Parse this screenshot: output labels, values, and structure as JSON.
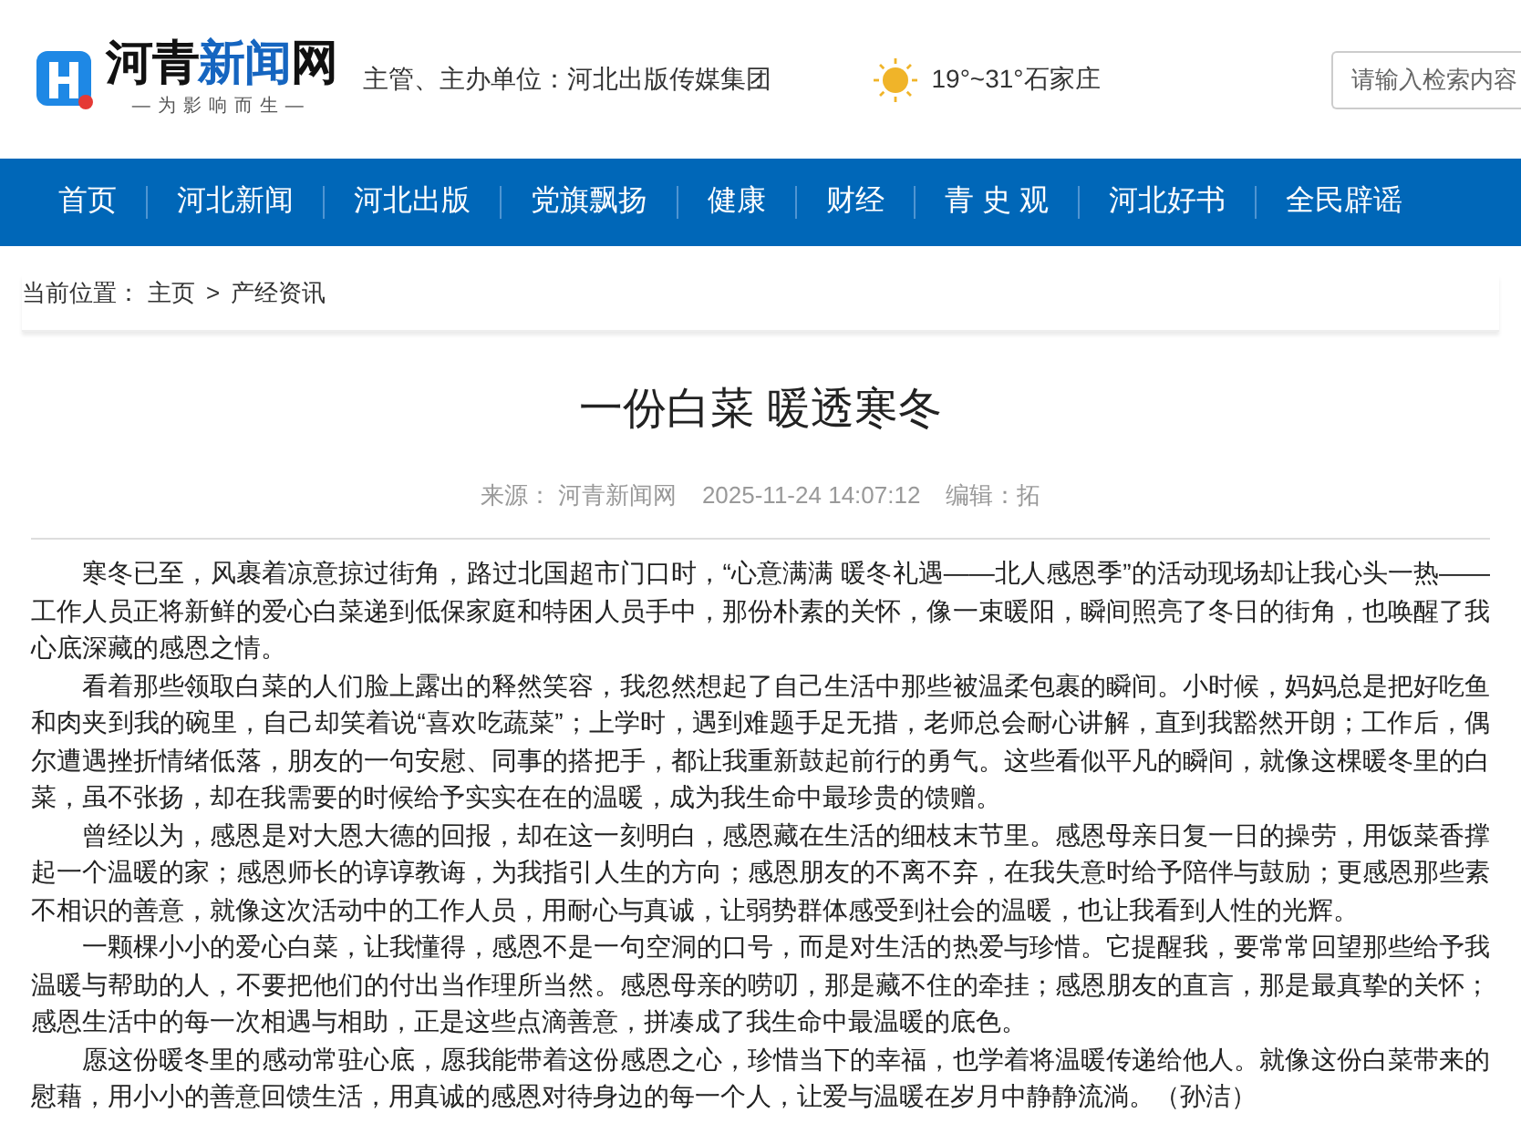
{
  "header": {
    "logo": {
      "parts": [
        {
          "text": "河青",
          "kind": "dark"
        },
        {
          "text": "新闻",
          "kind": "accent"
        },
        {
          "text": "网",
          "kind": "dark"
        }
      ],
      "slogan": "—为影响而生—"
    },
    "sponsor": "主管、主办单位：河北出版传媒集团",
    "weather": "19°~31°石家庄",
    "search": {
      "placeholder": "请输入检索内容"
    }
  },
  "nav": [
    {
      "label": "首页"
    },
    {
      "label": "河北新闻"
    },
    {
      "label": "河北出版"
    },
    {
      "label": "党旗飘扬"
    },
    {
      "label": "健康"
    },
    {
      "label": "财经"
    },
    {
      "label": "青 史 观"
    },
    {
      "label": "河北好书"
    },
    {
      "label": "全民辟谣"
    }
  ],
  "breadcrumb": {
    "label": "当前位置：",
    "items": [
      "主页",
      "产经资讯"
    ],
    "separator": ">"
  },
  "article": {
    "title": "一份白菜 暖透寒冬",
    "source_label": "来源：",
    "source": "河青新闻网",
    "date": "2025-11-24 14:07:12",
    "editor_label": "编辑：",
    "editor": "拓",
    "paragraphs": [
      "寒冬已至，风裹着凉意掠过街角，路过北国超市门口时，“心意满满  暖冬礼遇——北人感恩季”的活动现场却让我心头一热——工作人员正将新鲜的爱心白菜递到低保家庭和特困人员手中，那份朴素的关怀，像一束暖阳，瞬间照亮了冬日的街角，也唤醒了我心底深藏的感恩之情。",
      "看着那些领取白菜的人们脸上露出的释然笑容，我忽然想起了自己生活中那些被温柔包裹的瞬间。小时候，妈妈总是把好吃鱼和肉夹到我的碗里，自己却笑着说“喜欢吃蔬菜”；上学时，遇到难题手足无措，老师总会耐心讲解，直到我豁然开朗；工作后，偶尔遭遇挫折情绪低落，朋友的一句安慰、同事的搭把手，都让我重新鼓起前行的勇气。这些看似平凡的瞬间，就像这棵暖冬里的白菜，虽不张扬，却在我需要的时候给予实实在在的温暖，成为我生命中最珍贵的馈赠。",
      "曾经以为，感恩是对大恩大德的回报，却在这一刻明白，感恩藏在生活的细枝末节里。感恩母亲日复一日的操劳，用饭菜香撑起一个温暖的家；感恩师长的谆谆教诲，为我指引人生的方向；感恩朋友的不离不弃，在我失意时给予陪伴与鼓励；更感恩那些素不相识的善意，就像这次活动中的工作人员，用耐心与真诚，让弱势群体感受到社会的温暖，也让我看到人性的光辉。",
      "一颗棵小小的爱心白菜，让我懂得，感恩不是一句空洞的口号，而是对生活的热爱与珍惜。它提醒我，要常常回望那些给予我温暖与帮助的人，不要把他们的付出当作理所当然。感恩母亲的唠叨，那是藏不住的牵挂；感恩朋友的直言，那是最真挚的关怀；感恩生活中的每一次相遇与相助，正是这些点滴善意，拼凑成了我生命中最温暖的底色。",
      "愿这份暖冬里的感动常驻心底，愿我能带着这份感恩之心，珍惜当下的幸福，也学着将温暖传递给他人。就像这份白菜带来的慰藉，用小小的善意回馈生活，用真诚的感恩对待身边的每一个人，让爱与温暖在岁月中静静流淌。（孙洁）"
    ]
  }
}
